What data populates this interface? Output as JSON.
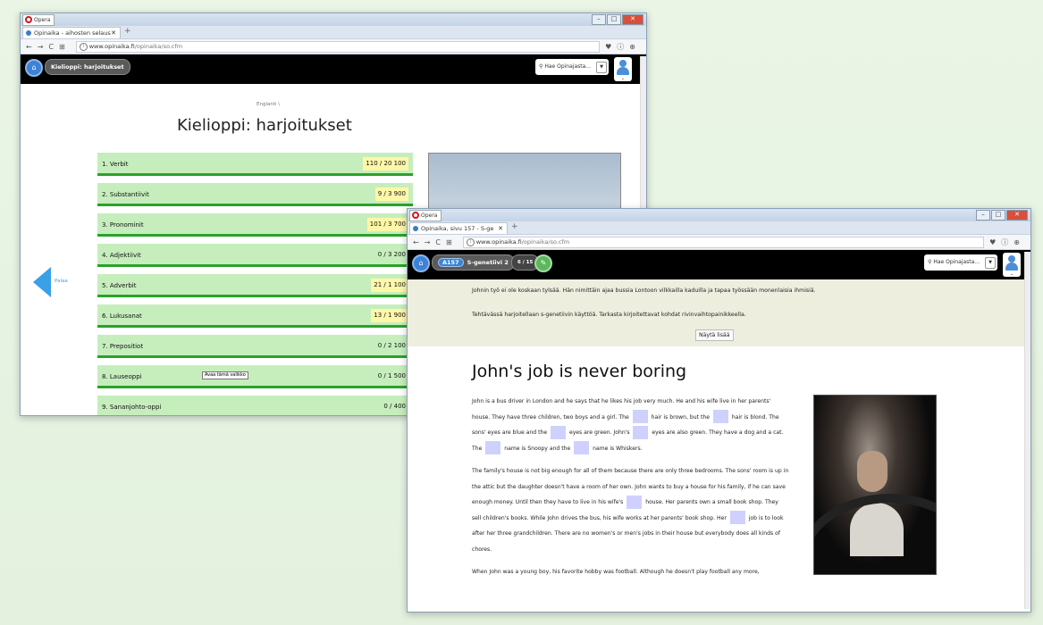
{
  "opera_label": "Opera",
  "window1": {
    "tab_title": "Opinaika - aihosten selaus",
    "url_host": "www.opinaika.fi",
    "url_path": "/opinaika/so.cfm",
    "header_pill": "Kielioppi: harjoitukset",
    "search_placeholder": "Hae Opinajasta...",
    "breadcrumb": "Englanti \\",
    "title": "Kielioppi: harjoitukset",
    "back_label": "Palaa",
    "tooltip": "Avaa tämä valikko",
    "items": [
      {
        "label": "1. Verbit",
        "score": "110 / 20 100",
        "highlight": true
      },
      {
        "label": "2. Substantiivit",
        "score": "9 / 3 900",
        "highlight": true
      },
      {
        "label": "3. Pronominit",
        "score": "101 / 3 700",
        "highlight": true
      },
      {
        "label": "4. Adjektiivit",
        "score": "0 / 3 200",
        "highlight": false
      },
      {
        "label": "5. Adverbit",
        "score": "21 / 1 100",
        "highlight": true
      },
      {
        "label": "6. Lukusanat",
        "score": "13 / 1 900",
        "highlight": true
      },
      {
        "label": "7. Prepositiot",
        "score": "0 / 2 100",
        "highlight": false
      },
      {
        "label": "8. Lauseoppi",
        "score": "0 / 1 500",
        "highlight": false
      },
      {
        "label": "9. Sananjohto-oppi",
        "score": "0 / 400",
        "highlight": false
      }
    ]
  },
  "window2": {
    "tab_title": "Opinaika, sivu 157 - S-ge",
    "url_host": "www.opinaika.fi",
    "url_path": "/opinaika/so.cfm",
    "badge_code": "A157",
    "exercise_title": "S-genetiivi 2",
    "counter": "6 / 15",
    "search_placeholder": "Hae Opinajasta...",
    "intro_1": "Johnin työ ei ole koskaan tylsää. Hän nimittäin ajaa bussia Lontoon vilkkailla kaduilla ja tapaa työssään monenlaisia ihmisiä.",
    "intro_2": "Tehtävässä harjoitellaan s-genetiivin käyttöä. Tarkasta kirjoitettavat kohdat rivinvaihtopainikkeella.",
    "show_more": "Näytä lisää",
    "article_title": "John's job is never boring",
    "p1_a": "John is a bus driver in London and he says that he likes his job very much. He and his wife live in her parents' house. They have three children, two boys and a girl. The",
    "p1_b": "hair is brown, but the",
    "p1_c": "hair is blond. The sons' eyes are blue and the",
    "p1_d": "eyes are green. John's",
    "p1_e": "eyes are also green. They have a dog and a cat. The",
    "p1_f": "name is Snoopy and the",
    "p1_g": "name is Whiskers.",
    "p2_a": "The family's house is not big enough for all of them because there are only three bedrooms. The sons' room is up in the attic but the daughter doesn't have a room of her own. John wants to buy a house for his family, if he can save enough money. Until then they have to live in his wife's",
    "p2_b": "house. Her parents own a small book shop. They sell children's books. While John drives the bus, his wife works at her parents' book shop. Her",
    "p2_c": "job is to look after her three grandchildren. There are no women's or men's jobs in their house but everybody does all kinds of chores.",
    "p3": "When John was a young boy, his favorite hobby was football. Although he doesn't play football any more,"
  }
}
